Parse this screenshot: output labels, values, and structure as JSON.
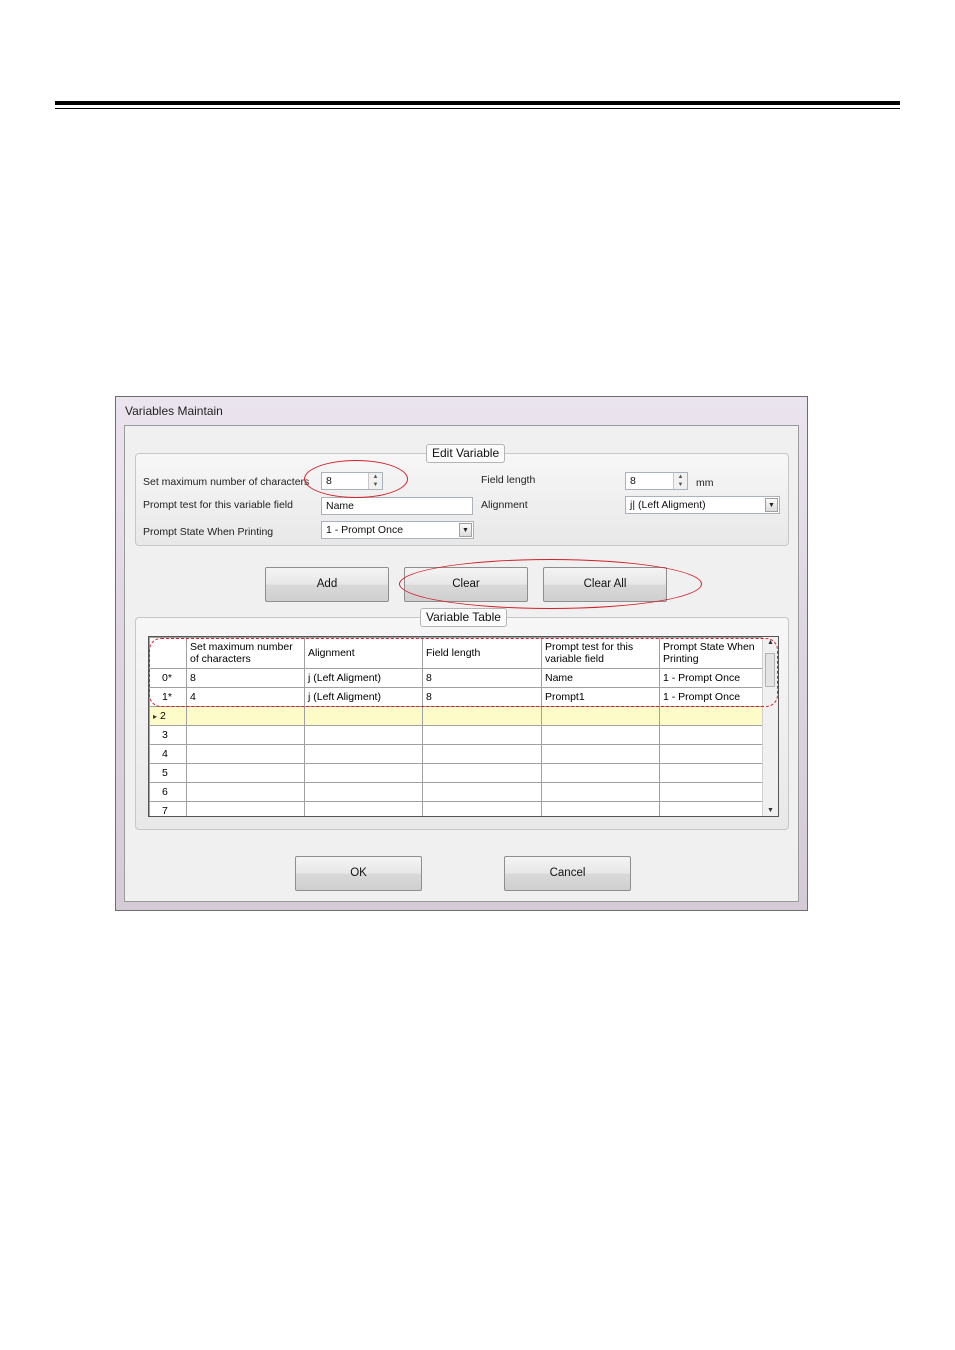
{
  "window": {
    "title": "Variables Maintain"
  },
  "edit_variable": {
    "title": "Edit Variable",
    "max_chars_label": "Set maximum number of characters",
    "max_chars_value": "8",
    "prompt_text_label": "Prompt test for this variable field",
    "prompt_text_value": "Name",
    "prompt_state_label": "Prompt State When Printing",
    "prompt_state_value": "1 - Prompt Once",
    "field_length_label": "Field length",
    "field_length_value": "8",
    "field_length_unit": "mm",
    "alignment_label": "Alignment",
    "alignment_value": "j|   (Left Aligment)"
  },
  "buttons": {
    "add": "Add",
    "clear": "Clear",
    "clear_all": "Clear All",
    "ok": "OK",
    "cancel": "Cancel"
  },
  "variable_table": {
    "title": "Variable Table",
    "columns": [
      "Set maximum number of characters",
      "Alignment",
      "Field length",
      "Prompt test for this variable field",
      "Prompt State When Printing"
    ],
    "rows": [
      {
        "index": "0*",
        "max_chars": "8",
        "alignment": "j    (Left Aligment)",
        "field_length": "8",
        "prompt_text": "Name",
        "prompt_state": "1 - Prompt Once"
      },
      {
        "index": "1*",
        "max_chars": "4",
        "alignment": "j    (Left Aligment)",
        "field_length": "8",
        "prompt_text": "Prompt1",
        "prompt_state": "1 - Prompt Once"
      },
      {
        "index": "2",
        "max_chars": "",
        "alignment": "",
        "field_length": "",
        "prompt_text": "",
        "prompt_state": ""
      },
      {
        "index": "3",
        "max_chars": "",
        "alignment": "",
        "field_length": "",
        "prompt_text": "",
        "prompt_state": ""
      },
      {
        "index": "4",
        "max_chars": "",
        "alignment": "",
        "field_length": "",
        "prompt_text": "",
        "prompt_state": ""
      },
      {
        "index": "5",
        "max_chars": "",
        "alignment": "",
        "field_length": "",
        "prompt_text": "",
        "prompt_state": ""
      },
      {
        "index": "6",
        "max_chars": "",
        "alignment": "",
        "field_length": "",
        "prompt_text": "",
        "prompt_state": ""
      },
      {
        "index": "7",
        "max_chars": "",
        "alignment": "",
        "field_length": "",
        "prompt_text": "",
        "prompt_state": ""
      }
    ],
    "selected_row_indicator": "▸"
  },
  "icons": {
    "spin_up": "spin-up-icon",
    "spin_down": "spin-down-icon",
    "dropdown": "chevron-down-icon",
    "row_pointer": "row-pointer-icon"
  },
  "colors": {
    "annotation_red": "#d21f2b",
    "current_row_highlight": "#fdfcc8"
  }
}
